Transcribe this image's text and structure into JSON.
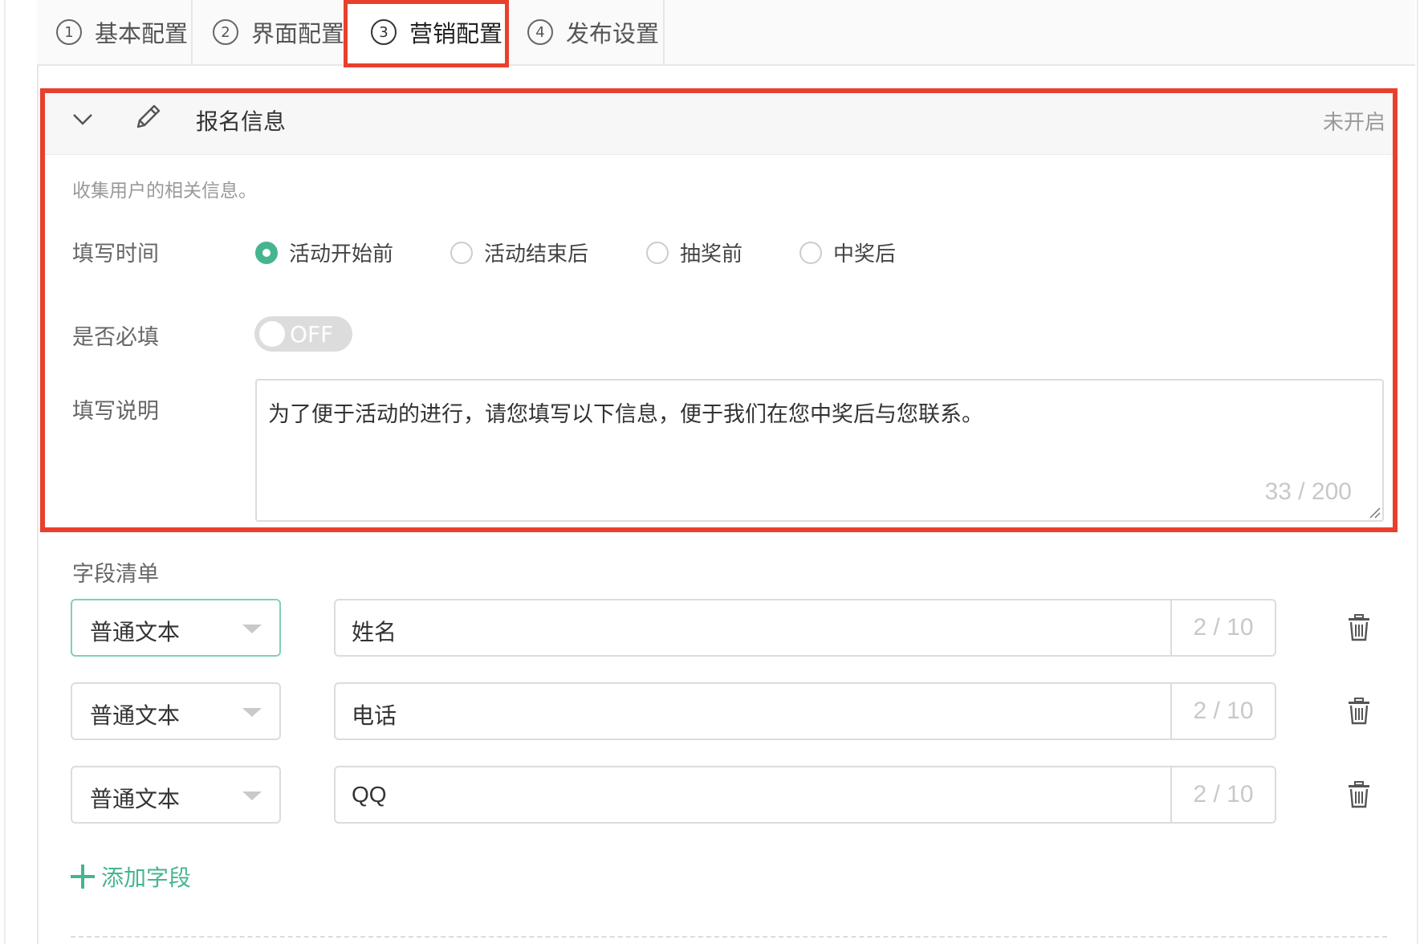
{
  "tabs": [
    {
      "num": "1",
      "label": "基本配置"
    },
    {
      "num": "2",
      "label": "界面配置"
    },
    {
      "num": "3",
      "label": "营销配置"
    },
    {
      "num": "4",
      "label": "发布设置"
    }
  ],
  "section": {
    "title": "报名信息",
    "status": "未开启",
    "description": "收集用户的相关信息。",
    "fill_time": {
      "label": "填写时间",
      "options": [
        "活动开始前",
        "活动结束后",
        "抽奖前",
        "中奖后"
      ],
      "selected": "活动开始前"
    },
    "required": {
      "label": "是否必填",
      "toggle_text": "OFF"
    },
    "instructions": {
      "label": "填写说明",
      "value": "为了便于活动的进行，请您填写以下信息，便于我们在您中奖后与您联系。",
      "count": "33 / 200"
    }
  },
  "fields": {
    "label": "字段清单",
    "rows": [
      {
        "type": "普通文本",
        "name": "姓名",
        "count": "2 / 10"
      },
      {
        "type": "普通文本",
        "name": "电话",
        "count": "2 / 10"
      },
      {
        "type": "普通文本",
        "name": "QQ",
        "count": "2 / 10"
      }
    ],
    "add_label": "添加字段"
  },
  "colors": {
    "accent": "#46b58f",
    "highlight": "#e8402d"
  }
}
